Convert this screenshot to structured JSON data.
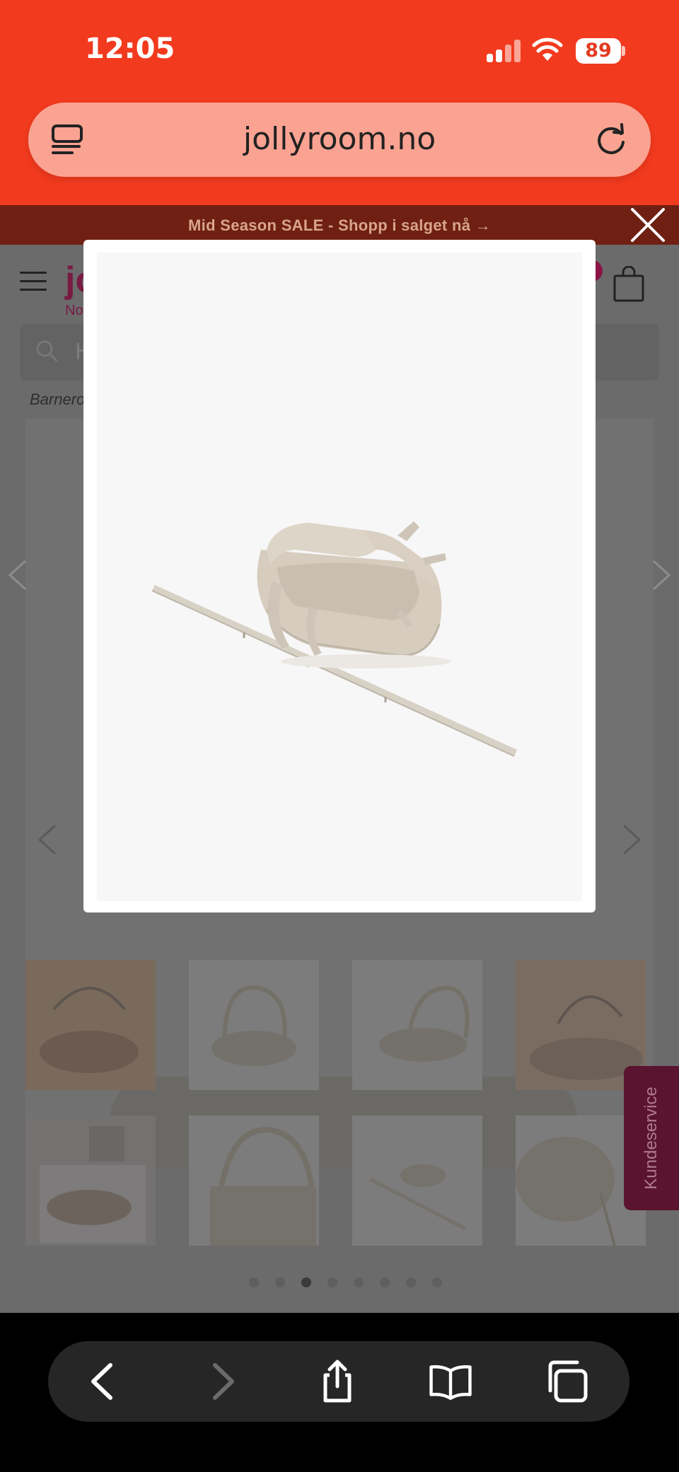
{
  "status_bar": {
    "time": "12:05",
    "battery": "89",
    "icons": [
      "signal-icon",
      "wifi-icon",
      "battery-icon"
    ]
  },
  "browser": {
    "url": "jollyroom.no",
    "icons": [
      "tabs-overview-icon",
      "reload-icon"
    ]
  },
  "page": {
    "promo_banner": "Mid Season SALE - Shopp i salget nå →",
    "logo_fragment": "jo",
    "logo_sub_fragment": "No",
    "search_placeholder_fragment": "H",
    "breadcrumb_fragment": "Barnero",
    "customer_service_tab": "Kundeservice",
    "thumbnail_count": 8,
    "carousel_dots": 8,
    "carousel_active_index": 2
  },
  "modal": {
    "image_alt": "Babynest med bøyle",
    "close_icon": "close-icon"
  },
  "bottom_toolbar": {
    "buttons": [
      "back-icon",
      "forward-icon",
      "share-icon",
      "bookmarks-icon",
      "tabs-icon"
    ]
  },
  "colors": {
    "chrome_red": "#f23a1e",
    "urlbar_fill": "#fba392",
    "brand": "#8a1446"
  }
}
